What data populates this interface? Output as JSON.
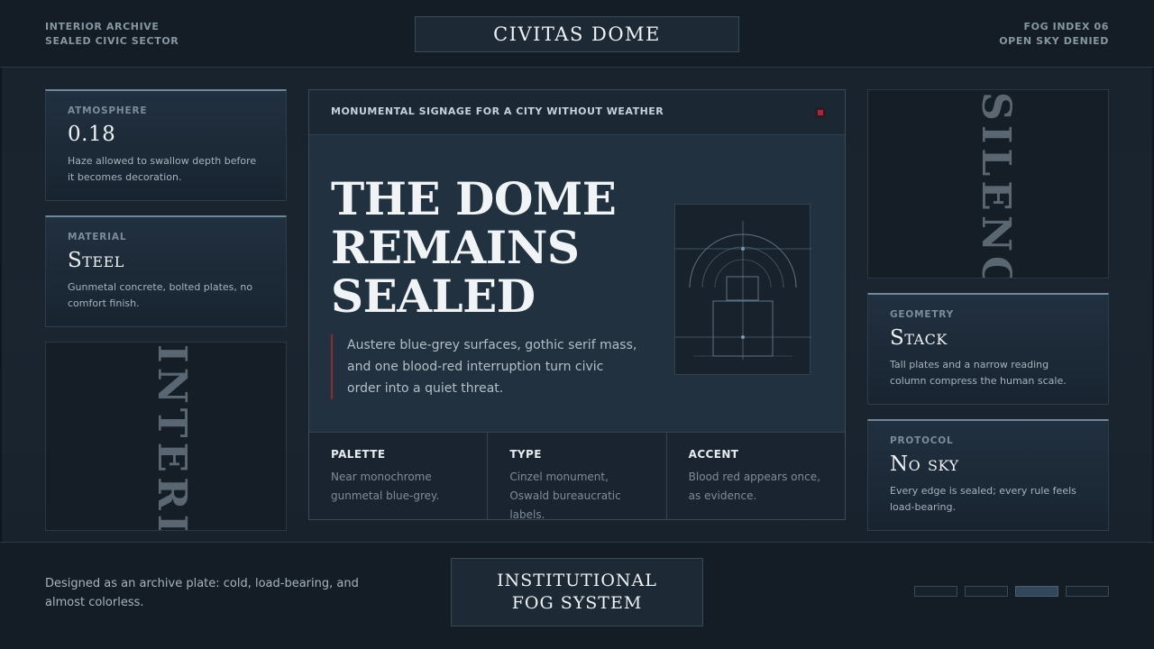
{
  "header": {
    "left_line1": "INTERIOR ARCHIVE",
    "left_line2": "SEALED CIVIC SECTOR",
    "title": "CIVITAS DOME",
    "right_line1": "FOG INDEX 06",
    "right_line2": "OPEN SKY DENIED"
  },
  "left_cards": [
    {
      "label": "ATMOSPHERE",
      "value": "0.18",
      "desc": "Haze allowed to swallow depth before it becomes decoration."
    },
    {
      "label": "MATERIAL",
      "value": "Steel",
      "desc": "Gunmetal concrete, bolted plates, no comfort finish."
    }
  ],
  "left_vertical_word": "INTERIOR",
  "right_vertical_word": "SILENCE",
  "right_cards": [
    {
      "label": "GEOMETRY",
      "value": "Stack",
      "desc": "Tall plates and a narrow reading column compress the human scale."
    },
    {
      "label": "PROTOCOL",
      "value": "No sky",
      "desc": "Every edge is sealed; every rule feels load-bearing."
    }
  ],
  "main": {
    "kicker": "MONUMENTAL SIGNAGE FOR A CITY WITHOUT WEATHER",
    "headline_1": "THE DOME",
    "headline_2": "REMAINS",
    "headline_3": "SEALED",
    "quote": "Austere blue-grey surfaces, gothic serif mass, and one blood-red interruption turn civic order into a quiet threat.",
    "columns": [
      {
        "label": "PALETTE",
        "desc": "Near monochrome gunmetal blue-grey."
      },
      {
        "label": "TYPE",
        "desc": "Cinzel monument, Oswald bureaucratic labels."
      },
      {
        "label": "ACCENT",
        "desc": "Blood red appears once, as evidence."
      }
    ]
  },
  "footer": {
    "note": "Designed as an archive plate: cold, load-bearing, and almost colorless.",
    "plate": "INSTITUTIONAL FOG SYSTEM",
    "pager_count": 4,
    "pager_active": 3
  },
  "colors": {
    "background": "#16202a",
    "accent_red": "#a8263a",
    "steel_line": "#6f8798"
  }
}
